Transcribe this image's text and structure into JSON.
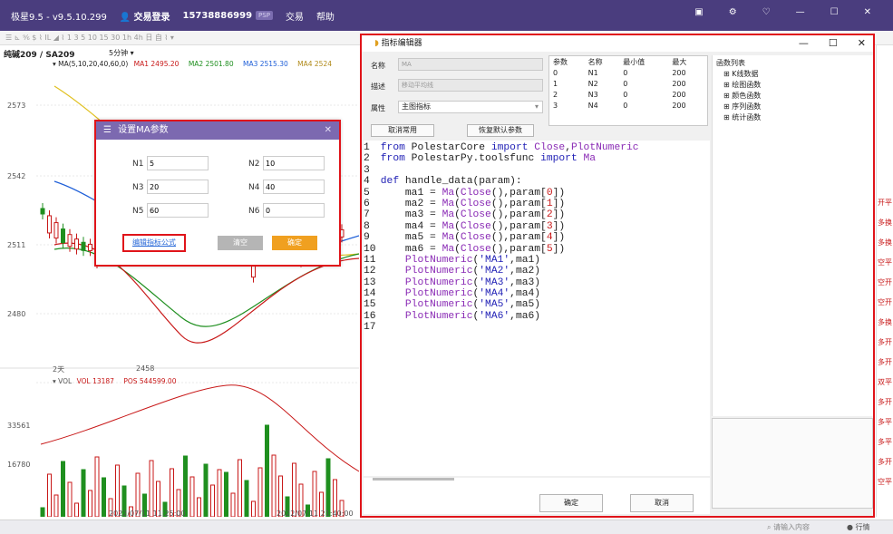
{
  "titlebar": {
    "app": "极星9.5 - v9.5.10.299",
    "login": "交易登录",
    "phone": "15738886999",
    "badge": "PSP",
    "trade": "交易",
    "help": "帮助"
  },
  "toolbar": {
    "text": "☰ ⊾ ⁹⁄₆ $ ⌇ ⅠⅬ ◢ ⌇ 1 3 5 10 15 30 1h 4h 日 自 ⌇ ▾"
  },
  "chart": {
    "contract": "纯碱209 / SA209",
    "period": "5分钟 ▾",
    "ma_legend": [
      "▾ MA(5,10,20,40,60,0)",
      "MA1 2495.20",
      "MA2 2501.80",
      "MA3 2515.30",
      "MA4 2524"
    ],
    "ma_colors": [
      "#c81818",
      "#1f8f1f",
      "#1f5fd8",
      "#b08a1a"
    ],
    "price_labels": [
      "2573",
      "2542",
      "2511",
      "2480"
    ],
    "day_label": "2天",
    "low_label": "2458",
    "vol_legend": [
      "▾ VOL",
      "VOL 13187",
      "POS 544599.00"
    ],
    "vol_labels": [
      "33561",
      "16780"
    ],
    "time_labels": [
      "2022/07/11 11:25:00",
      "2022/07/11 21:40:00"
    ]
  },
  "ma_dialog": {
    "title": "设置MA参数",
    "fields": [
      {
        "label": "N1",
        "value": "5"
      },
      {
        "label": "N2",
        "value": "10"
      },
      {
        "label": "N3",
        "value": "20"
      },
      {
        "label": "N4",
        "value": "40"
      },
      {
        "label": "N5",
        "value": "60"
      },
      {
        "label": "N6",
        "value": "0"
      }
    ],
    "edit_formula": "编辑指标公式",
    "clear": "清空",
    "confirm": "确定"
  },
  "editor": {
    "title": "指标编辑器",
    "name_label": "名称",
    "name_value": "MA",
    "desc_label": "描述",
    "desc_value": "移动平均线",
    "attr_label": "属性",
    "attr_value": "主图指标",
    "cancel_common": "取消常用",
    "restore_default": "恢复默认参数",
    "param_headers": [
      "参数",
      "名称",
      "最小值",
      "最大"
    ],
    "params": [
      [
        "0",
        "N1",
        "0",
        "200"
      ],
      [
        "1",
        "N2",
        "0",
        "200"
      ],
      [
        "2",
        "N3",
        "0",
        "200"
      ],
      [
        "3",
        "N4",
        "0",
        "200"
      ]
    ],
    "code_lines": [
      "from PolestarCore import Close,PlotNumeric",
      "from PolestarPy.toolsfunc import Ma",
      "",
      "def handle_data(param):",
      "    ma1 = Ma(Close(),param[0])",
      "    ma2 = Ma(Close(),param[1])",
      "    ma3 = Ma(Close(),param[2])",
      "    ma4 = Ma(Close(),param[3])",
      "    ma5 = Ma(Close(),param[4])",
      "    ma6 = Ma(Close(),param[5])",
      "    PlotNumeric('MA1',ma1)",
      "    PlotNumeric('MA2',ma2)",
      "    PlotNumeric('MA3',ma3)",
      "    PlotNumeric('MA4',ma4)",
      "    PlotNumeric('MA5',ma5)",
      "    PlotNumeric('MA6',ma6)",
      ""
    ],
    "func_list_title": "函数列表",
    "func_groups": [
      "K线数据",
      "绘图函数",
      "颜色函数",
      "序列函数",
      "统计函数"
    ],
    "ok": "确定",
    "cancel": "取消"
  },
  "right_strip": [
    "开平",
    "多换",
    "多换",
    "空平",
    "空开",
    "空开",
    "多换",
    "多开",
    "多开",
    "双平",
    "多开",
    "多平",
    "多平",
    "多开",
    "空平"
  ],
  "statusbar": {
    "search_placeholder": "请输入内容",
    "market": "行情"
  }
}
